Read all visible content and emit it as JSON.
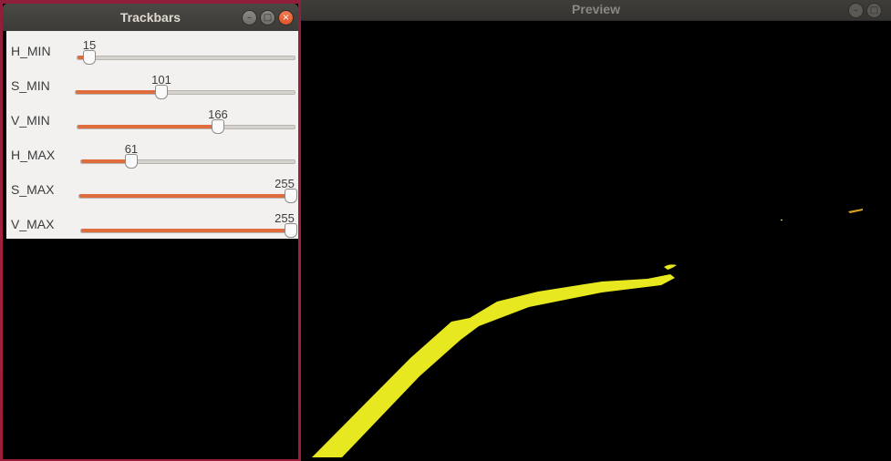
{
  "trackbars": {
    "title": "Trackbars",
    "sliders": [
      {
        "label": "H_MIN",
        "value": "15",
        "fraction": 0.059
      },
      {
        "label": "S_MIN",
        "value": "101",
        "fraction": 0.396
      },
      {
        "label": "V_MIN",
        "value": "166",
        "fraction": 0.651
      },
      {
        "label": "H_MAX",
        "value": "61",
        "fraction": 0.239
      },
      {
        "label": "S_MAX",
        "value": "255",
        "fraction": 1.0
      },
      {
        "label": "V_MAX",
        "value": "255",
        "fraction": 1.0
      }
    ],
    "accent": "#e06b3c",
    "icons": [
      "minimize-icon",
      "maximize-icon",
      "close-icon"
    ]
  },
  "preview": {
    "title": "Preview",
    "lane_color": "#e8e820",
    "icons": [
      "minimize-icon",
      "maximize-icon"
    ]
  }
}
